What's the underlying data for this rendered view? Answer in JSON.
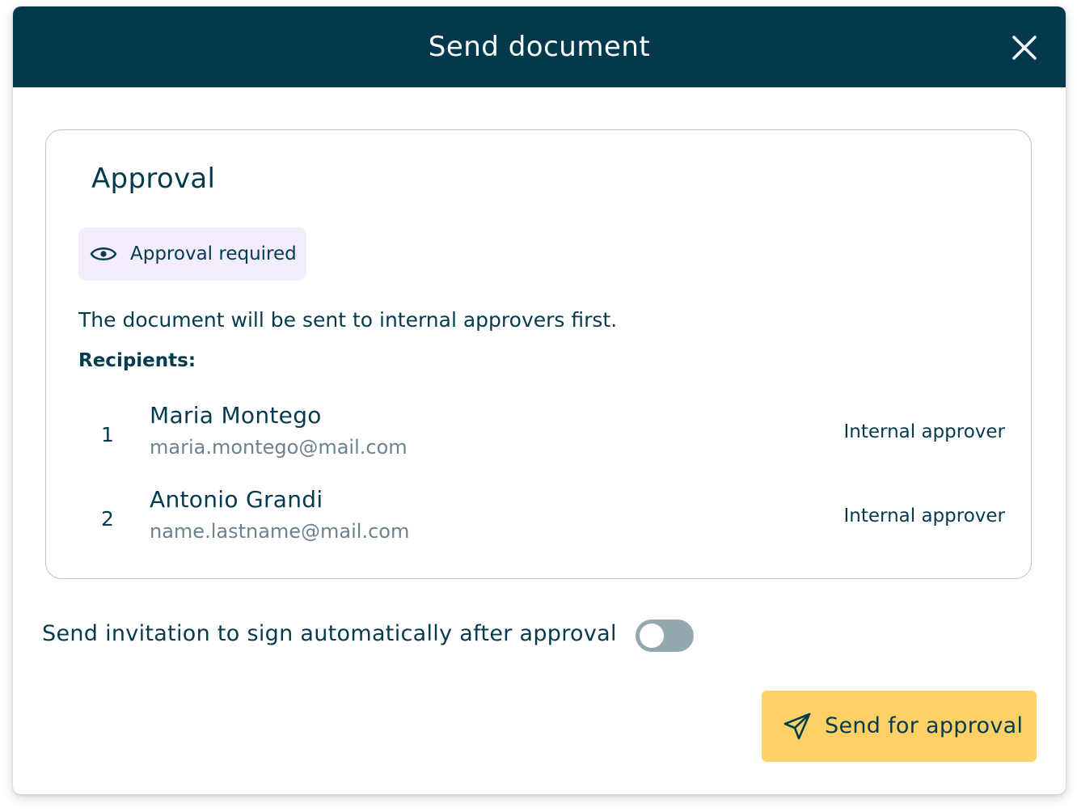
{
  "modal": {
    "title": "Send document",
    "close_icon": "close-icon"
  },
  "approval": {
    "title": "Approval",
    "badge_icon": "eye-icon",
    "badge_label": "Approval required",
    "description": "The document will be sent to internal approvers first.",
    "recipients_label": "Recipients:",
    "recipients": [
      {
        "order": "1",
        "name": "Maria Montego",
        "email": "maria.montego@mail.com",
        "role": "Internal approver"
      },
      {
        "order": "2",
        "name": "Antonio Grandi",
        "email": "name.lastname@mail.com",
        "role": "Internal approver"
      }
    ]
  },
  "auto_invite": {
    "label": "Send invitation to sign automatically after approval",
    "enabled": false
  },
  "send_button": {
    "icon": "paper-plane-icon",
    "label": "Send for approval"
  },
  "colors": {
    "header_bg": "#03394d",
    "text_primary": "#053b4e",
    "text_secondary": "#6b8390",
    "badge_bg": "#f2ecfc",
    "toggle_off": "#94a8b0",
    "primary_button": "#fdd166"
  }
}
